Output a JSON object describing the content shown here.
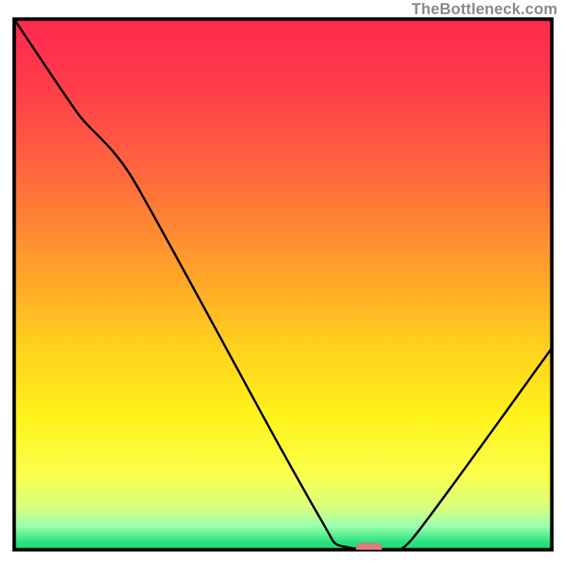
{
  "watermark": "TheBottleneck.com",
  "colors": {
    "frame": "#000000",
    "curve": "#000000",
    "marker_fill": "#e47a7d",
    "marker_stroke": "#d86c70",
    "gradient_stops": [
      {
        "offset": 0.0,
        "color": "#ff2a4f"
      },
      {
        "offset": 0.12,
        "color": "#ff3a4a"
      },
      {
        "offset": 0.3,
        "color": "#ff6a3d"
      },
      {
        "offset": 0.48,
        "color": "#ffa329"
      },
      {
        "offset": 0.62,
        "color": "#ffd21e"
      },
      {
        "offset": 0.75,
        "color": "#fff31a"
      },
      {
        "offset": 0.86,
        "color": "#fbff4d"
      },
      {
        "offset": 0.92,
        "color": "#d7ff7e"
      },
      {
        "offset": 0.955,
        "color": "#9dffae"
      },
      {
        "offset": 0.985,
        "color": "#2be27f"
      },
      {
        "offset": 1.0,
        "color": "#1ed879"
      }
    ]
  },
  "chart_data": {
    "type": "line",
    "title": "",
    "xlabel": "",
    "ylabel": "",
    "xlim": [
      0,
      100
    ],
    "ylim": [
      0,
      100
    ],
    "grid": false,
    "legend": false,
    "series": [
      {
        "name": "bottleneck-curve",
        "x": [
          0,
          12,
          22,
          48,
          58,
          60,
          65,
          68,
          74,
          100
        ],
        "values": [
          100,
          82,
          70,
          22,
          4,
          1,
          0,
          0,
          2,
          38
        ]
      }
    ],
    "annotations": [
      {
        "name": "optimal-marker",
        "x": 66,
        "y": 0,
        "shape": "pill"
      }
    ],
    "background": "heatmap-vertical-gradient"
  }
}
